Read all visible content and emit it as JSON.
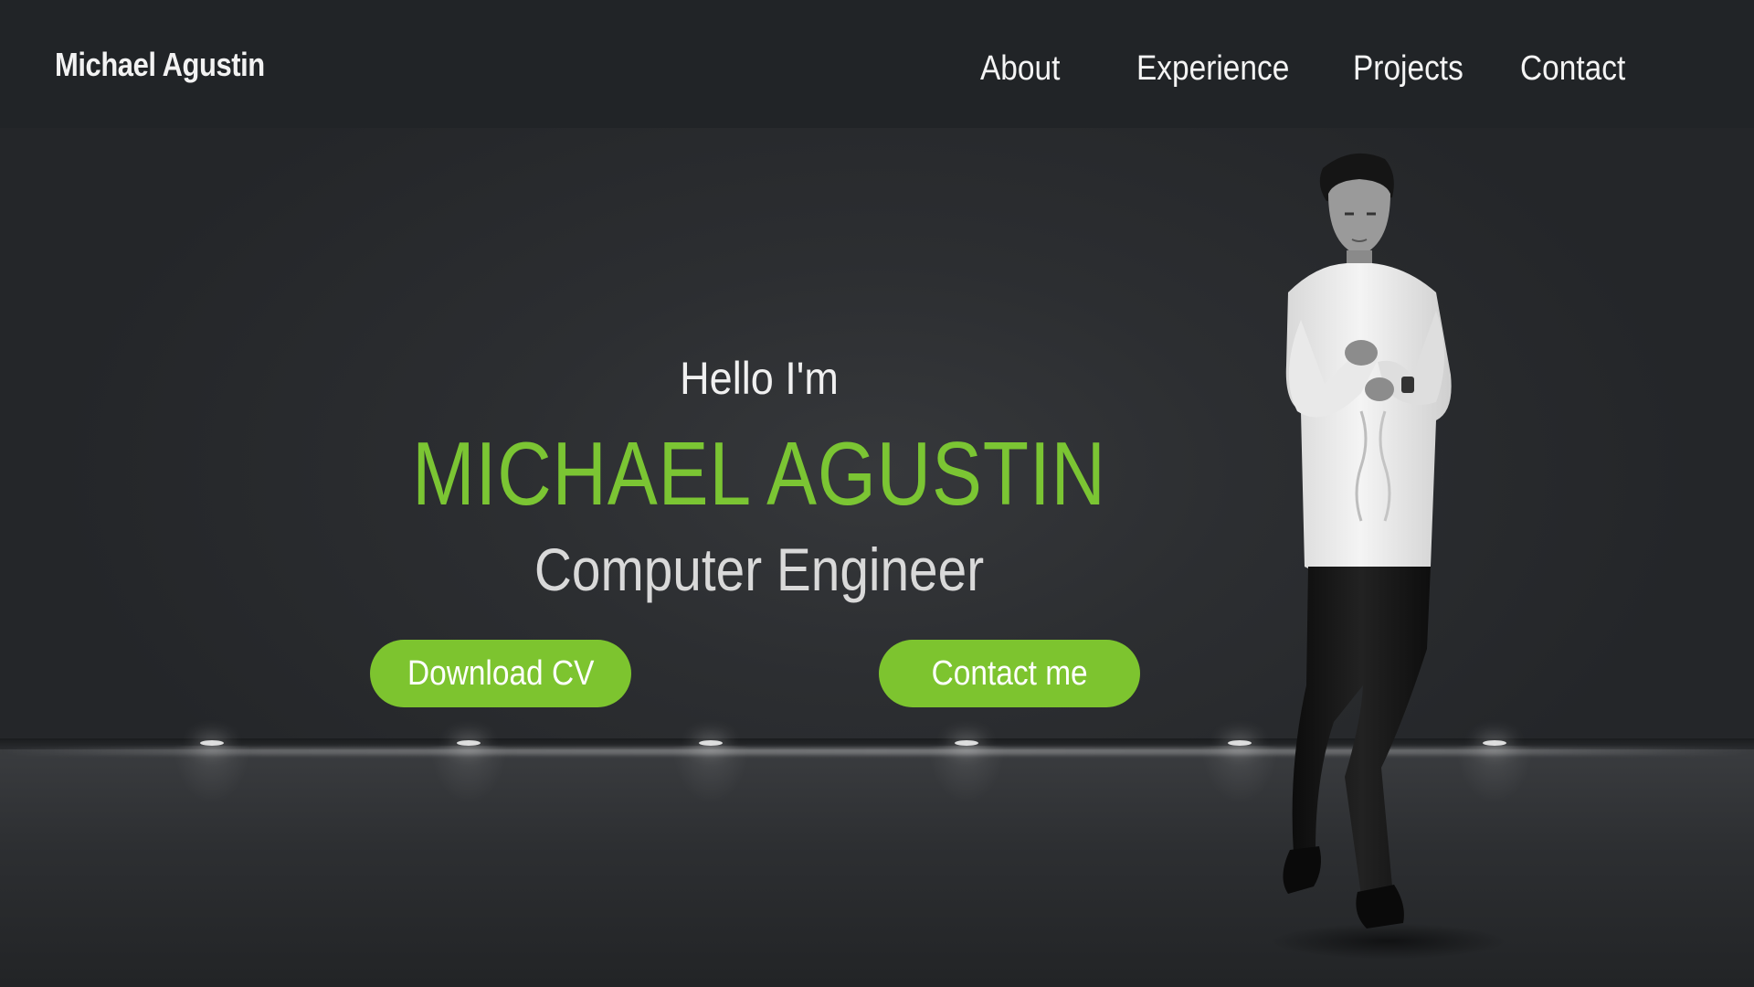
{
  "header": {
    "brand": "Michael Agustin",
    "nav": [
      {
        "label": "About"
      },
      {
        "label": "Experience"
      },
      {
        "label": "Projects"
      },
      {
        "label": "Contact"
      }
    ]
  },
  "hero": {
    "greeting": "Hello I'm",
    "name": "MICHAEL AGUSTIN",
    "role": "Computer Engineer",
    "buttons": {
      "download_cv": "Download CV",
      "contact_me": "Contact me"
    },
    "profile_image": "portrait-photo"
  },
  "colors": {
    "accent": "#7dc42f",
    "header_bg": "#212427",
    "hero_bg": "#2c2e31",
    "text": "#f0f0f0"
  }
}
